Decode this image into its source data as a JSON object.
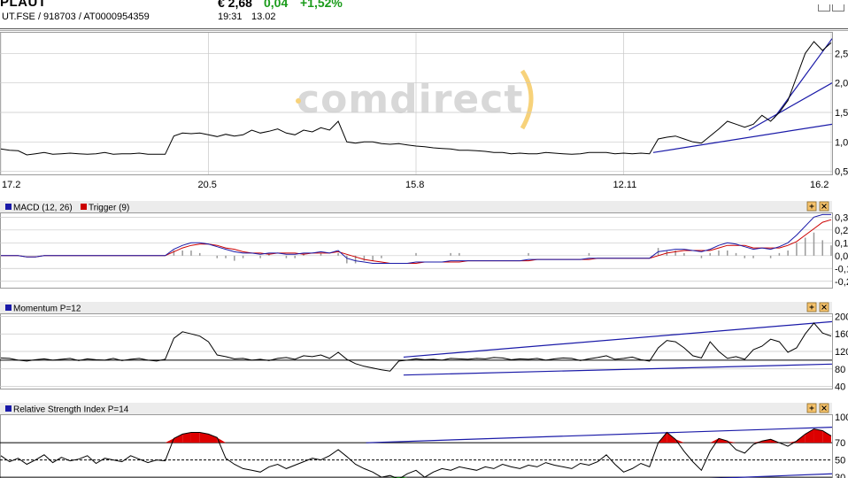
{
  "header": {
    "ticker": "PLAUT",
    "ids": "UT.FSE  /  918703  /  AT0000954359",
    "price": "€ 2,68",
    "change": "0,04",
    "change_pct": "+1,52%",
    "time": "19:31",
    "date": "13.02"
  },
  "watermark": "comdirect",
  "colors": {
    "price_line": "#000000",
    "trend_line": "#1a1aa8",
    "macd": "#1a1aa8",
    "trigger": "#cc0000",
    "rsi_overbought": "#dd0000",
    "rsi_oversold": "#1a9b1a",
    "panel_header": "#ececec",
    "grid": "#c8c8c8"
  },
  "icons": [
    "expand-icon",
    "close-icon",
    "chart-type-icon"
  ],
  "chart_data": [
    {
      "type": "line",
      "id": "price",
      "x_ticks": [
        "17.2",
        "20.5",
        "15.8",
        "12.11",
        "16.2"
      ],
      "y_ticks": [
        "0,5",
        "1,0",
        "1,5",
        "2,0",
        "2,5"
      ],
      "ylim": [
        0.45,
        2.85
      ],
      "grid": true,
      "y_values": [
        0.88,
        0.86,
        0.85,
        0.78,
        0.8,
        0.82,
        0.79,
        0.8,
        0.81,
        0.8,
        0.79,
        0.8,
        0.82,
        0.79,
        0.8,
        0.8,
        0.81,
        0.79,
        0.79,
        0.79,
        1.1,
        1.15,
        1.14,
        1.15,
        1.12,
        1.09,
        1.13,
        1.1,
        1.12,
        1.2,
        1.15,
        1.18,
        1.22,
        1.15,
        1.12,
        1.2,
        1.17,
        1.24,
        1.2,
        1.35,
        1.0,
        0.98,
        1.0,
        1.0,
        0.97,
        0.96,
        0.97,
        0.95,
        0.93,
        0.92,
        0.9,
        0.89,
        0.88,
        0.86,
        0.86,
        0.85,
        0.84,
        0.82,
        0.82,
        0.8,
        0.81,
        0.8,
        0.8,
        0.82,
        0.81,
        0.8,
        0.79,
        0.8,
        0.82,
        0.82,
        0.82,
        0.8,
        0.81,
        0.8,
        0.81,
        0.8,
        1.05,
        1.08,
        1.1,
        1.05,
        1.0,
        0.98,
        1.1,
        1.22,
        1.35,
        1.3,
        1.25,
        1.3,
        1.45,
        1.35,
        1.5,
        1.7,
        2.1,
        2.5,
        2.7,
        2.55,
        2.68
      ],
      "trend_lines": [
        {
          "x0": 0.785,
          "y0": 0.82,
          "x1": 1.0,
          "y1": 1.3
        },
        {
          "x0": 0.9,
          "y0": 1.2,
          "x1": 1.0,
          "y1": 2.0
        },
        {
          "x0": 0.93,
          "y0": 1.4,
          "x1": 1.0,
          "y1": 2.75
        }
      ]
    },
    {
      "type": "line",
      "id": "macd",
      "title": "MACD (12, 26)",
      "trigger_label": "Trigger (9)",
      "y_ticks": [
        "-0,2",
        "-0,1",
        "0,0",
        "0,1",
        "0,2",
        "0,3"
      ],
      "ylim": [
        -0.25,
        0.33
      ],
      "series": [
        {
          "name": "MACD (12, 26)",
          "values": [
            0,
            0,
            0,
            -0.01,
            -0.01,
            0,
            0,
            0,
            0,
            0,
            0,
            0,
            0,
            0,
            0,
            0,
            0,
            0,
            0,
            0,
            0.05,
            0.08,
            0.1,
            0.1,
            0.09,
            0.07,
            0.05,
            0.03,
            0.02,
            0.02,
            0.01,
            0.02,
            0.02,
            0.01,
            0.01,
            0.02,
            0.02,
            0.03,
            0.02,
            0.04,
            -0.02,
            -0.04,
            -0.05,
            -0.06,
            -0.06,
            -0.06,
            -0.06,
            -0.06,
            -0.05,
            -0.05,
            -0.05,
            -0.05,
            -0.04,
            -0.04,
            -0.04,
            -0.04,
            -0.04,
            -0.04,
            -0.04,
            -0.04,
            -0.04,
            -0.03,
            -0.03,
            -0.03,
            -0.03,
            -0.03,
            -0.03,
            -0.03,
            -0.02,
            -0.02,
            -0.02,
            -0.02,
            -0.02,
            -0.02,
            -0.02,
            -0.02,
            0.03,
            0.04,
            0.05,
            0.05,
            0.04,
            0.03,
            0.05,
            0.08,
            0.1,
            0.09,
            0.07,
            0.05,
            0.06,
            0.05,
            0.07,
            0.1,
            0.16,
            0.23,
            0.3,
            0.32,
            0.32
          ]
        },
        {
          "name": "Trigger (9)",
          "values": [
            0,
            0,
            0,
            -0.01,
            -0.01,
            0,
            0,
            0,
            0,
            0,
            0,
            0,
            0,
            0,
            0,
            0,
            0,
            0,
            0,
            0,
            0.03,
            0.06,
            0.08,
            0.09,
            0.09,
            0.08,
            0.06,
            0.05,
            0.03,
            0.02,
            0.02,
            0.01,
            0.02,
            0.02,
            0.02,
            0.01,
            0.02,
            0.02,
            0.02,
            0.03,
            0.01,
            -0.01,
            -0.03,
            -0.04,
            -0.05,
            -0.06,
            -0.06,
            -0.06,
            -0.06,
            -0.05,
            -0.05,
            -0.05,
            -0.05,
            -0.05,
            -0.04,
            -0.04,
            -0.04,
            -0.04,
            -0.04,
            -0.04,
            -0.04,
            -0.04,
            -0.03,
            -0.03,
            -0.03,
            -0.03,
            -0.03,
            -0.03,
            -0.03,
            -0.02,
            -0.02,
            -0.02,
            -0.02,
            -0.02,
            -0.02,
            -0.02,
            0.0,
            0.02,
            0.03,
            0.04,
            0.04,
            0.04,
            0.04,
            0.06,
            0.08,
            0.08,
            0.08,
            0.06,
            0.06,
            0.06,
            0.06,
            0.08,
            0.11,
            0.16,
            0.21,
            0.26,
            0.28
          ]
        }
      ]
    },
    {
      "type": "line",
      "id": "momentum",
      "title": "Momentum P=12",
      "y_ticks": [
        "40",
        "80",
        "120",
        "160",
        "200"
      ],
      "ylim": [
        35,
        205
      ],
      "y_values": [
        105,
        104,
        100,
        98,
        101,
        103,
        100,
        102,
        104,
        99,
        103,
        101,
        100,
        104,
        99,
        102,
        104,
        100,
        98,
        102,
        150,
        165,
        160,
        155,
        142,
        112,
        108,
        103,
        104,
        100,
        102,
        99,
        104,
        106,
        102,
        110,
        108,
        112,
        104,
        118,
        102,
        92,
        86,
        82,
        78,
        75,
        98,
        100,
        103,
        101,
        102,
        100,
        104,
        103,
        102,
        104,
        103,
        106,
        105,
        101,
        103,
        102,
        104,
        100,
        103,
        105,
        104,
        99,
        103,
        106,
        110,
        102,
        104,
        107,
        101,
        98,
        128,
        145,
        142,
        128,
        110,
        105,
        142,
        120,
        104,
        108,
        102,
        124,
        132,
        148,
        142,
        118,
        128,
        160,
        185,
        162,
        155
      ],
      "trend_lines": [
        {
          "x0": 0.485,
          "y0": 107,
          "x1": 1.0,
          "y1": 188
        },
        {
          "x0": 0.485,
          "y0": 66,
          "x1": 1.0,
          "y1": 91
        }
      ],
      "ref_line": 100
    },
    {
      "type": "line",
      "id": "rsi",
      "title": "Relative Strength Index P=14",
      "y_ticks": [
        "30",
        "50",
        "70",
        "100"
      ],
      "ylim": [
        25,
        102
      ],
      "ref_lines": [
        30,
        50,
        70
      ],
      "y_values": [
        55,
        48,
        52,
        45,
        50,
        56,
        47,
        53,
        49,
        51,
        55,
        46,
        52,
        50,
        48,
        55,
        51,
        47,
        50,
        49,
        75,
        80,
        82,
        82,
        80,
        76,
        52,
        45,
        40,
        38,
        36,
        42,
        45,
        40,
        44,
        48,
        52,
        50,
        55,
        62,
        54,
        45,
        40,
        36,
        30,
        32,
        28,
        34,
        38,
        30,
        36,
        40,
        38,
        42,
        40,
        38,
        42,
        40,
        45,
        42,
        40,
        44,
        42,
        47,
        44,
        42,
        40,
        46,
        44,
        48,
        56,
        45,
        36,
        40,
        46,
        42,
        70,
        82,
        74,
        60,
        48,
        38,
        60,
        75,
        72,
        62,
        58,
        68,
        72,
        74,
        70,
        66,
        72,
        80,
        86,
        84,
        78
      ],
      "trend_lines": [
        {
          "x0": 0.44,
          "y0": 70,
          "x1": 1.0,
          "y1": 88
        },
        {
          "x0": 0.545,
          "y0": 17,
          "x1": 1.0,
          "y1": 34
        }
      ]
    }
  ]
}
